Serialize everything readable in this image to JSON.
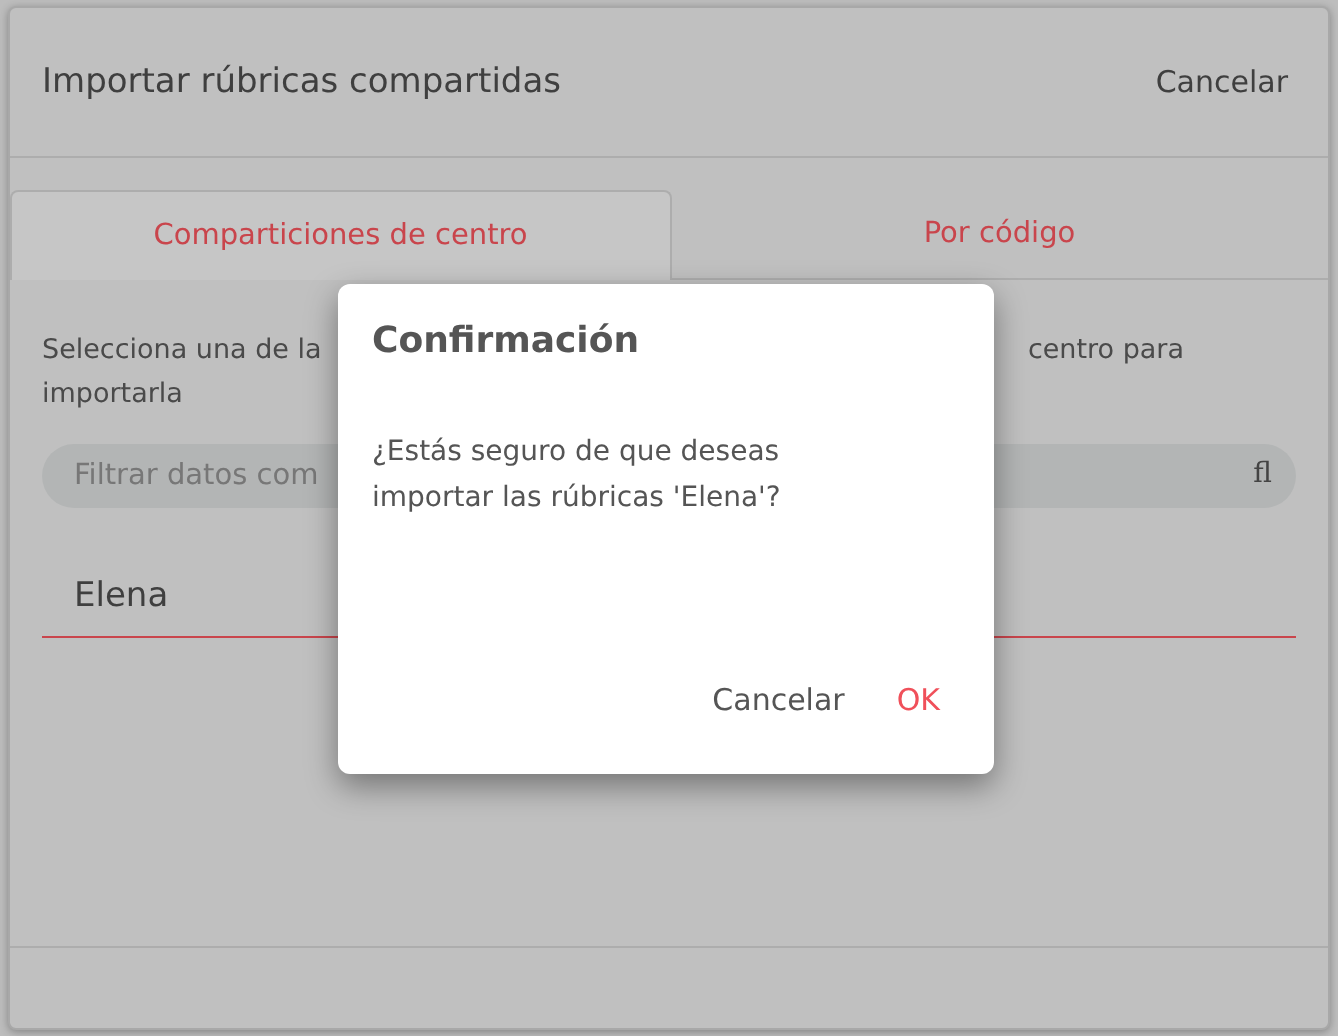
{
  "window": {
    "title": "Importar rúbricas compartidas",
    "cancel": "Cancelar"
  },
  "tabs": [
    {
      "label": "Comparticiones de centro",
      "selected": true
    },
    {
      "label": "Por código",
      "selected": false
    }
  ],
  "instructions": {
    "left_line_1": "Selecciona una de la",
    "right_line_1": "centro para",
    "line_2": "importarla"
  },
  "search": {
    "placeholder": "Filtrar datos com",
    "icon_text": "fl"
  },
  "list": [
    {
      "label": "Elena"
    }
  ],
  "dialog": {
    "title": "Confirmación",
    "message": "¿Estás seguro de que deseas importar las rúbricas 'Elena'?",
    "buttons": [
      {
        "label": "Cancelar",
        "kind": "secondary"
      },
      {
        "label": "OK",
        "kind": "primary"
      }
    ]
  }
}
